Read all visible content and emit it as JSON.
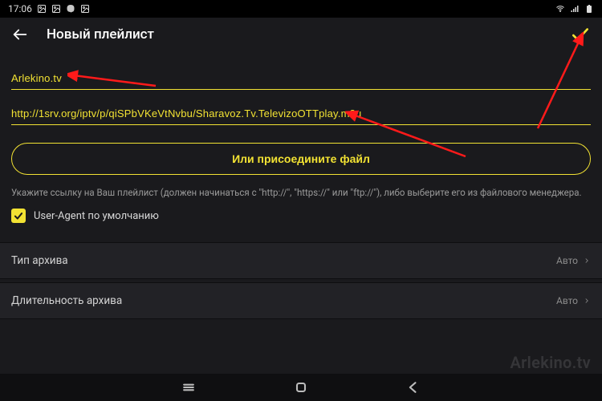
{
  "status": {
    "time": "17:06"
  },
  "header": {
    "title": "Новый плейлист"
  },
  "form": {
    "name_value": "Arlekino.tv",
    "url_value": "http://1srv.org/iptv/p/qiSPbVKeVtNvbu/Sharavoz.Tv.TelevizoOTTplay.m3u",
    "attach_label": "Или присоедините файл",
    "hint": "Укажите ссылку на Ваш плейлист (должен начинаться с \"http://\", \"https://\" или \"ftp://\"), либо выберите его из файлового менеджера.",
    "user_agent_label": "User-Agent по умолчанию"
  },
  "settings": {
    "archive_type": {
      "label": "Тип архива",
      "value": "Авто"
    },
    "archive_duration": {
      "label": "Длительность архива",
      "value": "Авто"
    }
  },
  "watermark": "Arlekino.tv"
}
